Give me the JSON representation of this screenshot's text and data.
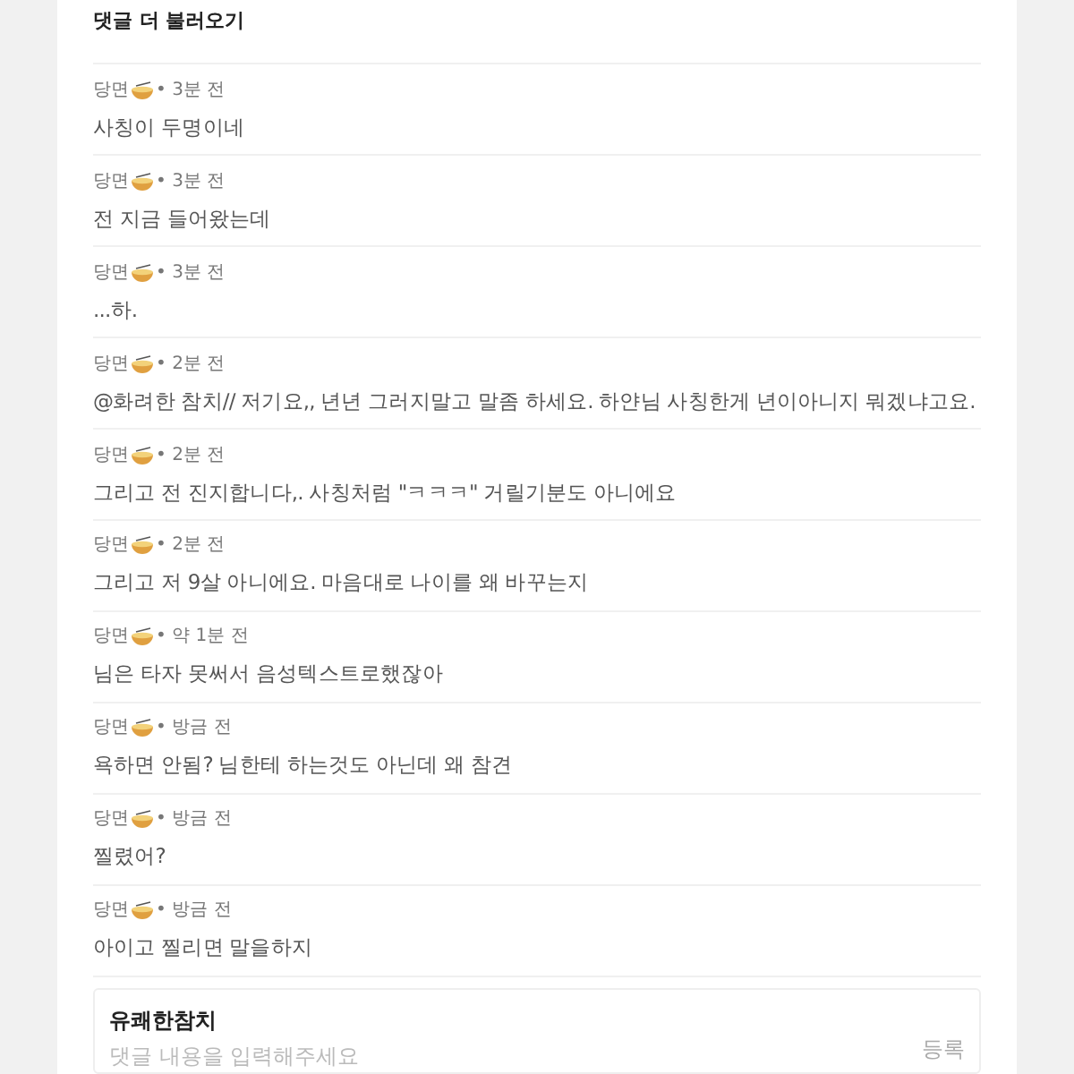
{
  "header": {
    "load_more": "댓글 더 불러오기"
  },
  "comments": [
    {
      "author": "당면",
      "time": "• 3분 전",
      "text": "사칭이 두명이네"
    },
    {
      "author": "당면",
      "time": "• 3분 전",
      "text": "전 지금 들어왔는데"
    },
    {
      "author": "당면",
      "time": "• 3분 전",
      "text": "...하."
    },
    {
      "author": "당면",
      "time": "• 2분 전",
      "text": "@화려한 참치// 저기요,, 년년 그러지말고 말좀 하세요. 하얀님 사칭한게 년이아니지 뭐겠냐고요."
    },
    {
      "author": "당면",
      "time": "• 2분 전",
      "text": "그리고 전 진지합니다,. 사칭처럼 \"ㅋㅋㅋ\" 거릴기분도 아니에요"
    },
    {
      "author": "당면",
      "time": "• 2분 전",
      "text": "그리고 저 9살 아니에요. 마음대로 나이를 왜 바꾸는지"
    },
    {
      "author": "당면",
      "time": "• 약 1분 전",
      "text": "님은 타자 못써서 음성텍스트로했잖아"
    },
    {
      "author": "당면",
      "time": "• 방금 전",
      "text": "욕하면 안됨? 님한테 하는것도 아닌데 왜 참견"
    },
    {
      "author": "당면",
      "time": "• 방금 전",
      "text": "찔렸어?"
    },
    {
      "author": "당면",
      "time": "• 방금 전",
      "text": "아이고 찔리면 말을하지"
    }
  ],
  "composer": {
    "user": "유쾌한참치",
    "placeholder": "댓글 내용을 입력해주세요",
    "submit": "등록"
  }
}
